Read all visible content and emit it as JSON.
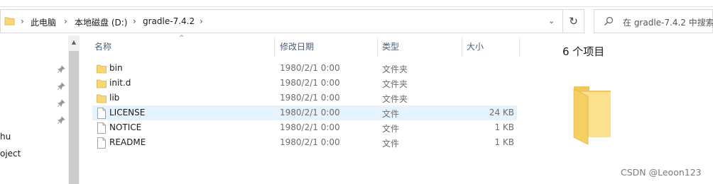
{
  "address_bar": {
    "crumbs": [
      "此电脑",
      "本地磁盘 (D:)",
      "gradle-7.4.2"
    ]
  },
  "search": {
    "placeholder": "在 gradle-7.4.2 中搜索"
  },
  "nav_pane": {
    "partial_items": [
      "hu",
      "oject"
    ]
  },
  "columns": {
    "name": "名称",
    "modified": "修改日期",
    "type": "类型",
    "size": "大小"
  },
  "files": [
    {
      "name": "bin",
      "modified": "1980/2/1 0:00",
      "type": "文件夹",
      "size": "",
      "icon": "folder-icon"
    },
    {
      "name": "init.d",
      "modified": "1980/2/1 0:00",
      "type": "文件夹",
      "size": "",
      "icon": "folder-icon"
    },
    {
      "name": "lib",
      "modified": "1980/2/1 0:00",
      "type": "文件夹",
      "size": "",
      "icon": "folder-icon"
    },
    {
      "name": "LICENSE",
      "modified": "1980/2/1 0:00",
      "type": "文件",
      "size": "24 KB",
      "icon": "file-icon"
    },
    {
      "name": "NOTICE",
      "modified": "1980/2/1 0:00",
      "type": "文件",
      "size": "1 KB",
      "icon": "file-icon"
    },
    {
      "name": "README",
      "modified": "1980/2/1 0:00",
      "type": "文件",
      "size": "1 KB",
      "icon": "file-icon"
    }
  ],
  "preview": {
    "count_label": "6 个项目"
  },
  "watermark": "CSDN @Leoon123",
  "colors": {
    "folder": "#f8d775",
    "selected_row": "#e5f3ff",
    "header_text": "#4c607a"
  }
}
